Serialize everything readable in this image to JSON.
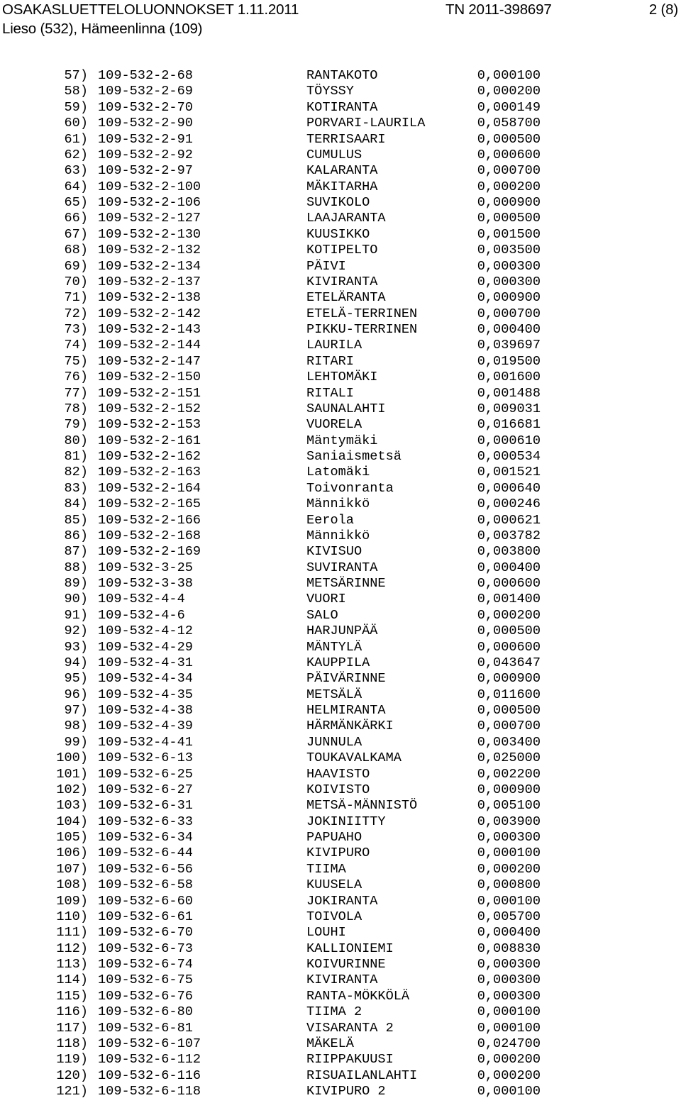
{
  "header": {
    "title": "OSAKASLUETTELOLUONNOKSET 1.11.2011",
    "reference": "TN 2011-398697",
    "page": "2 (8)",
    "subtitle": "Lieso (532), Hämeenlinna (109)"
  },
  "table": {
    "columns": [
      "index",
      "property_id",
      "name",
      "share"
    ],
    "rows": [
      {
        "index": "57)",
        "property_id": "109-532-2-68",
        "name": "RANTAKOTO",
        "share": "0,000100"
      },
      {
        "index": "58)",
        "property_id": "109-532-2-69",
        "name": "TÖYSSY",
        "share": "0,000200"
      },
      {
        "index": "59)",
        "property_id": "109-532-2-70",
        "name": "KOTIRANTA",
        "share": "0,000149"
      },
      {
        "index": "60)",
        "property_id": "109-532-2-90",
        "name": "PORVARI-LAURILA",
        "share": "0,058700"
      },
      {
        "index": "61)",
        "property_id": "109-532-2-91",
        "name": "TERRISAARI",
        "share": "0,000500"
      },
      {
        "index": "62)",
        "property_id": "109-532-2-92",
        "name": "CUMULUS",
        "share": "0,000600"
      },
      {
        "index": "63)",
        "property_id": "109-532-2-97",
        "name": "KALARANTA",
        "share": "0,000700"
      },
      {
        "index": "64)",
        "property_id": "109-532-2-100",
        "name": "MÄKITARHA",
        "share": "0,000200"
      },
      {
        "index": "65)",
        "property_id": "109-532-2-106",
        "name": "SUVIKOLO",
        "share": "0,000900"
      },
      {
        "index": "66)",
        "property_id": "109-532-2-127",
        "name": "LAAJARANTA",
        "share": "0,000500"
      },
      {
        "index": "67)",
        "property_id": "109-532-2-130",
        "name": "KUUSIKKO",
        "share": "0,001500"
      },
      {
        "index": "68)",
        "property_id": "109-532-2-132",
        "name": "KOTIPELTO",
        "share": "0,003500"
      },
      {
        "index": "69)",
        "property_id": "109-532-2-134",
        "name": "PÄIVI",
        "share": "0,000300"
      },
      {
        "index": "70)",
        "property_id": "109-532-2-137",
        "name": "KIVIRANTA",
        "share": "0,000300"
      },
      {
        "index": "71)",
        "property_id": "109-532-2-138",
        "name": "ETELÄRANTA",
        "share": "0,000900"
      },
      {
        "index": "72)",
        "property_id": "109-532-2-142",
        "name": "ETELÄ-TERRINEN",
        "share": "0,000700"
      },
      {
        "index": "73)",
        "property_id": "109-532-2-143",
        "name": "PIKKU-TERRINEN",
        "share": "0,000400"
      },
      {
        "index": "74)",
        "property_id": "109-532-2-144",
        "name": "LAURILA",
        "share": "0,039697"
      },
      {
        "index": "75)",
        "property_id": "109-532-2-147",
        "name": "RITARI",
        "share": "0,019500"
      },
      {
        "index": "76)",
        "property_id": "109-532-2-150",
        "name": "LEHTOMÄKI",
        "share": "0,001600"
      },
      {
        "index": "77)",
        "property_id": "109-532-2-151",
        "name": "RITALI",
        "share": "0,001488"
      },
      {
        "index": "78)",
        "property_id": "109-532-2-152",
        "name": "SAUNALAHTI",
        "share": "0,009031"
      },
      {
        "index": "79)",
        "property_id": "109-532-2-153",
        "name": "VUORELA",
        "share": "0,016681"
      },
      {
        "index": "80)",
        "property_id": "109-532-2-161",
        "name": "Mäntymäki",
        "share": "0,000610"
      },
      {
        "index": "81)",
        "property_id": "109-532-2-162",
        "name": "Saniaismetsä",
        "share": "0,000534"
      },
      {
        "index": "82)",
        "property_id": "109-532-2-163",
        "name": "Latomäki",
        "share": "0,001521"
      },
      {
        "index": "83)",
        "property_id": "109-532-2-164",
        "name": "Toivonranta",
        "share": "0,000640"
      },
      {
        "index": "84)",
        "property_id": "109-532-2-165",
        "name": "Männikkö",
        "share": "0,000246"
      },
      {
        "index": "85)",
        "property_id": "109-532-2-166",
        "name": "Eerola",
        "share": "0,000621"
      },
      {
        "index": "86)",
        "property_id": "109-532-2-168",
        "name": "Männikkö",
        "share": "0,003782"
      },
      {
        "index": "87)",
        "property_id": "109-532-2-169",
        "name": "KIVISUO",
        "share": "0,003800"
      },
      {
        "index": "88)",
        "property_id": "109-532-3-25",
        "name": "SUVIRANTA",
        "share": "0,000400"
      },
      {
        "index": "89)",
        "property_id": "109-532-3-38",
        "name": "METSÄRINNE",
        "share": "0,000600"
      },
      {
        "index": "90)",
        "property_id": "109-532-4-4",
        "name": "VUORI",
        "share": "0,001400"
      },
      {
        "index": "91)",
        "property_id": "109-532-4-6",
        "name": "SALO",
        "share": "0,000200"
      },
      {
        "index": "92)",
        "property_id": "109-532-4-12",
        "name": "HARJUNPÄÄ",
        "share": "0,000500"
      },
      {
        "index": "93)",
        "property_id": "109-532-4-29",
        "name": "MÄNTYLÄ",
        "share": "0,000600"
      },
      {
        "index": "94)",
        "property_id": "109-532-4-31",
        "name": "KAUPPILA",
        "share": "0,043647"
      },
      {
        "index": "95)",
        "property_id": "109-532-4-34",
        "name": "PÄIVÄRINNE",
        "share": "0,000900"
      },
      {
        "index": "96)",
        "property_id": "109-532-4-35",
        "name": "METSÄLÄ",
        "share": "0,011600"
      },
      {
        "index": "97)",
        "property_id": "109-532-4-38",
        "name": "HELMIRANTA",
        "share": "0,000500"
      },
      {
        "index": "98)",
        "property_id": "109-532-4-39",
        "name": "HÄRMÄNKÄRKI",
        "share": "0,000700"
      },
      {
        "index": "99)",
        "property_id": "109-532-4-41",
        "name": "JUNNULA",
        "share": "0,003400"
      },
      {
        "index": "100)",
        "property_id": "109-532-6-13",
        "name": "TOUKAVALKAMA",
        "share": "0,025000"
      },
      {
        "index": "101)",
        "property_id": "109-532-6-25",
        "name": "HAAVISTO",
        "share": "0,002200"
      },
      {
        "index": "102)",
        "property_id": "109-532-6-27",
        "name": "KOIVISTO",
        "share": "0,000900"
      },
      {
        "index": "103)",
        "property_id": "109-532-6-31",
        "name": "METSÄ-MÄNNISTÖ",
        "share": "0,005100"
      },
      {
        "index": "104)",
        "property_id": "109-532-6-33",
        "name": "JOKINIITTY",
        "share": "0,003900"
      },
      {
        "index": "105)",
        "property_id": "109-532-6-34",
        "name": "PAPUAHO",
        "share": "0,000300"
      },
      {
        "index": "106)",
        "property_id": "109-532-6-44",
        "name": "KIVIPURO",
        "share": "0,000100"
      },
      {
        "index": "107)",
        "property_id": "109-532-6-56",
        "name": "TIIMA",
        "share": "0,000200"
      },
      {
        "index": "108)",
        "property_id": "109-532-6-58",
        "name": "KUUSELA",
        "share": "0,000800"
      },
      {
        "index": "109)",
        "property_id": "109-532-6-60",
        "name": "JOKIRANTA",
        "share": "0,000100"
      },
      {
        "index": "110)",
        "property_id": "109-532-6-61",
        "name": "TOIVOLA",
        "share": "0,005700"
      },
      {
        "index": "111)",
        "property_id": "109-532-6-70",
        "name": "LOUHI",
        "share": "0,000400"
      },
      {
        "index": "112)",
        "property_id": "109-532-6-73",
        "name": "KALLIONIEMI",
        "share": "0,008830"
      },
      {
        "index": "113)",
        "property_id": "109-532-6-74",
        "name": "KOIVURINNE",
        "share": "0,000300"
      },
      {
        "index": "114)",
        "property_id": "109-532-6-75",
        "name": "KIVIRANTA",
        "share": "0,000300"
      },
      {
        "index": "115)",
        "property_id": "109-532-6-76",
        "name": "RANTA-MÖKKÖLÄ",
        "share": "0,000300"
      },
      {
        "index": "116)",
        "property_id": "109-532-6-80",
        "name": "TIIMA 2",
        "share": "0,000100"
      },
      {
        "index": "117)",
        "property_id": "109-532-6-81",
        "name": "VISARANTA 2",
        "share": "0,000100"
      },
      {
        "index": "118)",
        "property_id": "109-532-6-107",
        "name": "MÄKELÄ",
        "share": "0,024700"
      },
      {
        "index": "119)",
        "property_id": "109-532-6-112",
        "name": "RIIPPAKUUSI",
        "share": "0,000200"
      },
      {
        "index": "120)",
        "property_id": "109-532-6-116",
        "name": "RISUAILANLAHTI",
        "share": "0,000200"
      },
      {
        "index": "121)",
        "property_id": "109-532-6-118",
        "name": "KIVIPURO 2",
        "share": "0,000100"
      }
    ]
  }
}
